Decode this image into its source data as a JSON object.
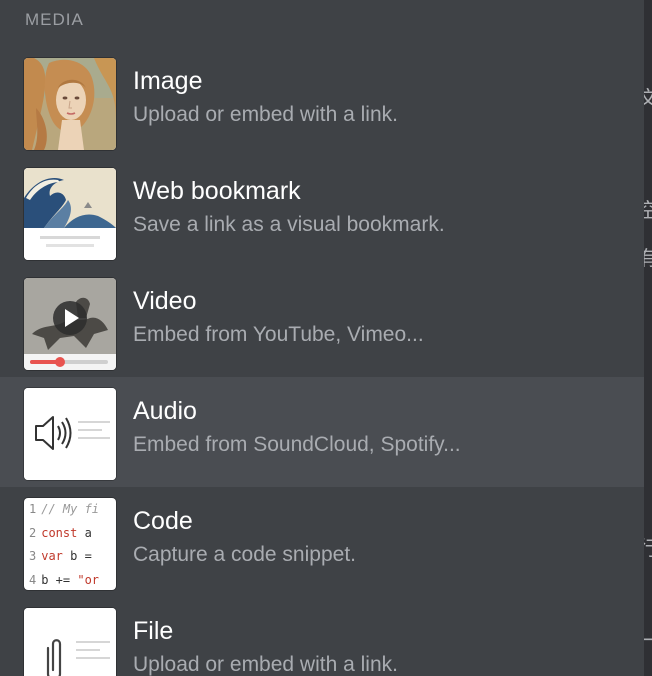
{
  "section": {
    "header": "MEDIA"
  },
  "items": [
    {
      "title": "Image",
      "description": "Upload or embed with a link.",
      "icon": "image-thumbnail"
    },
    {
      "title": "Web bookmark",
      "description": "Save a link as a visual bookmark.",
      "icon": "bookmark-thumbnail"
    },
    {
      "title": "Video",
      "description": "Embed from YouTube, Vimeo...",
      "icon": "video-thumbnail"
    },
    {
      "title": "Audio",
      "description": "Embed from SoundCloud, Spotify...",
      "icon": "speaker-icon",
      "highlighted": true
    },
    {
      "title": "Code",
      "description": "Capture a code snippet.",
      "icon": "code-thumbnail"
    },
    {
      "title": "File",
      "description": "Upload or embed with a link.",
      "icon": "paperclip-icon"
    }
  ],
  "code_preview": {
    "lines": [
      {
        "num": "1",
        "text": "// My fi"
      },
      {
        "num": "2",
        "kw": "const",
        "text": " a"
      },
      {
        "num": "3",
        "kw": "var",
        "text": " b ="
      },
      {
        "num": "4",
        "text": "b += ",
        "str": "\"or"
      }
    ]
  },
  "colors": {
    "menu_background": "#3f4246",
    "highlight_background": "#4a4d52",
    "title_text": "#ffffff",
    "description_text": "#a9acb1",
    "section_header_text": "#9b9ea3",
    "video_progress": "#e8534f"
  },
  "right_strip_glyphs": [
    "文",
    "空",
    "有",
    "行",
    "一"
  ]
}
